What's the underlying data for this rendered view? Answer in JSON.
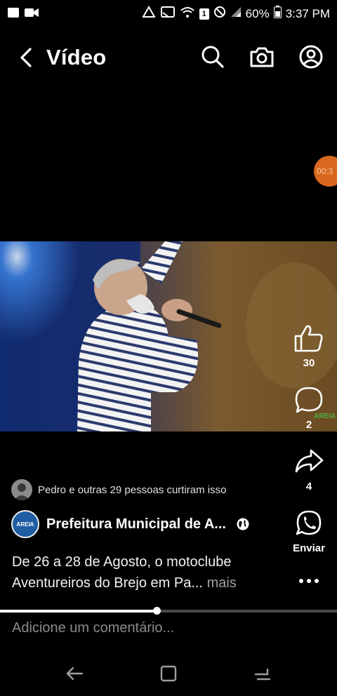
{
  "status_bar": {
    "battery_percent": "60%",
    "time": "3:37 PM",
    "sim_badge": "1",
    "icons": [
      "notification-icon",
      "video-call-icon",
      "sync-icon",
      "cast-icon",
      "wifi-icon",
      "sim-icon",
      "do-not-disturb-icon",
      "signal-icon",
      "battery-icon"
    ]
  },
  "header": {
    "title": "Vídeo",
    "icons": [
      "back-arrow-icon",
      "search-icon",
      "camera-icon",
      "profile-icon"
    ]
  },
  "timer_bubble": {
    "text": "00:3"
  },
  "video": {
    "overlay_text": "AREIA"
  },
  "actions": {
    "like": {
      "icon": "thumbs-up-icon",
      "count": "30"
    },
    "comment": {
      "icon": "comment-icon",
      "count": "2"
    },
    "share": {
      "icon": "share-arrow-icon",
      "count": "4"
    },
    "send": {
      "icon": "whatsapp-icon",
      "label": "Enviar"
    }
  },
  "post": {
    "likes_text": "Pedro e outras 29 pessoas curtiram isso",
    "page_name": "Prefeitura Municipal de A...",
    "page_avatar_text": "AREIA",
    "caption_line1": "De 26 a 28 de Agosto, o motoclube",
    "caption_line2": "Aventureiros do Brejo em Pa...",
    "more_label": "mais"
  },
  "playback": {
    "progress": 0.465
  },
  "comment_box": {
    "placeholder": "Adicione um comentário..."
  },
  "colors": {
    "background": "#000000",
    "timer_bubble": "#d9681f"
  }
}
